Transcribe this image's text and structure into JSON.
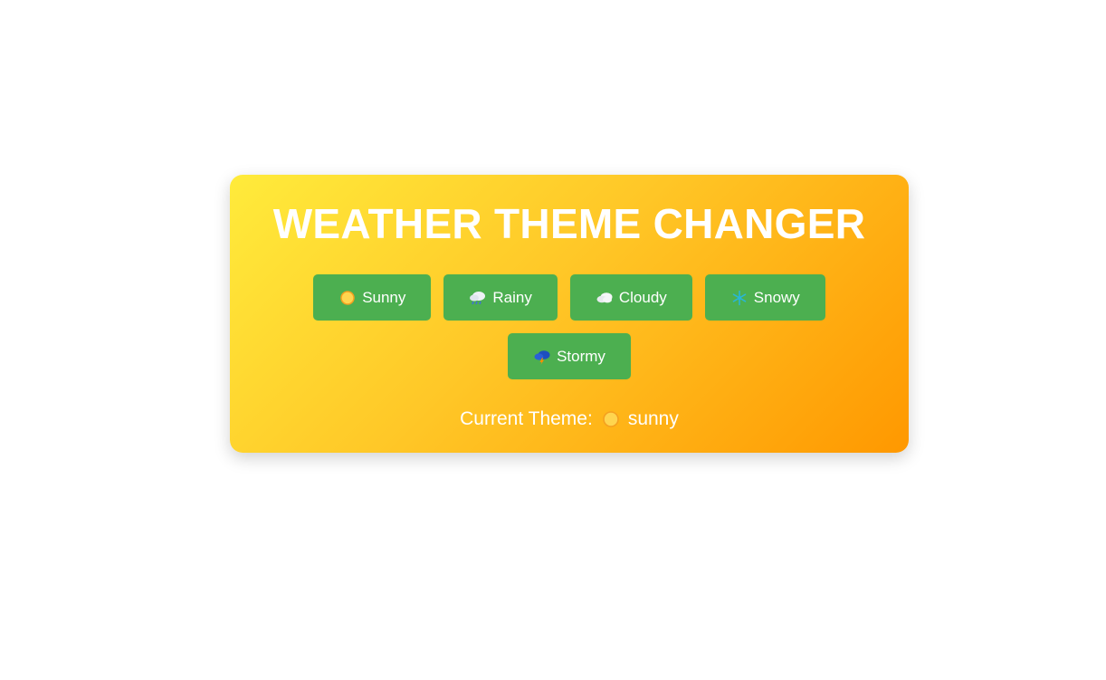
{
  "title": "WEATHER THEME CHANGER",
  "buttons": [
    {
      "label": "Sunny",
      "icon": "sun-icon"
    },
    {
      "label": "Rainy",
      "icon": "rain-cloud-icon"
    },
    {
      "label": "Cloudy",
      "icon": "cloud-icon"
    },
    {
      "label": "Snowy",
      "icon": "snowflake-icon"
    },
    {
      "label": "Stormy",
      "icon": "storm-cloud-icon"
    }
  ],
  "current_theme": {
    "label": "Current Theme:",
    "value": "sunny",
    "icon": "sun-icon"
  },
  "colors": {
    "button_bg": "#4caf50",
    "card_gradient_start": "#ffeb3b",
    "card_gradient_end": "#ff9800",
    "text": "#ffffff"
  }
}
